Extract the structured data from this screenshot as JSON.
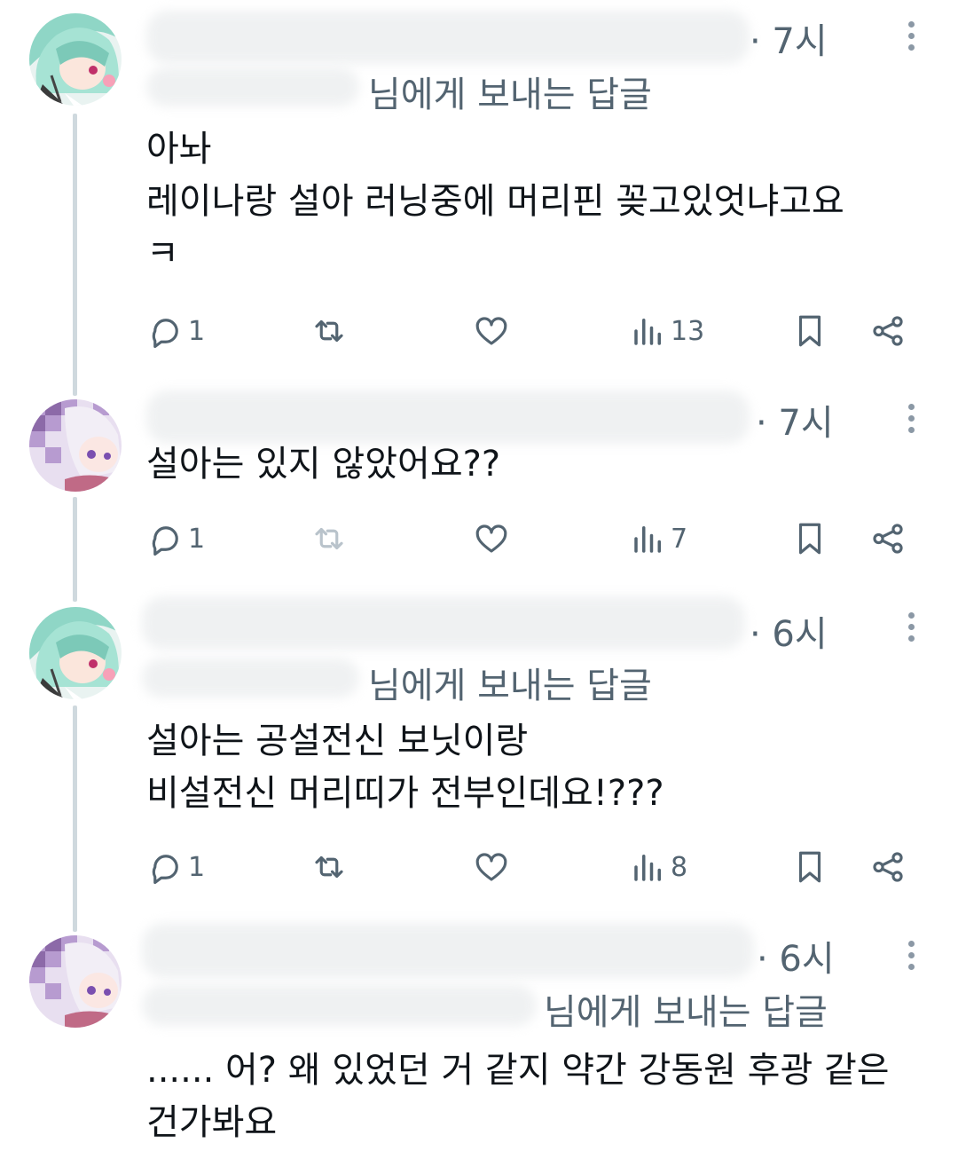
{
  "replying_suffix": "님에게 보내는 답글",
  "icons": [
    "reply-icon",
    "retweet-icon",
    "like-icon",
    "views-icon",
    "bookmark-icon",
    "share-icon",
    "more-icon"
  ],
  "colors": {
    "text": "#0f1419",
    "secondary": "#536471",
    "icon": "#536471",
    "thread_line": "#cfd9de"
  },
  "tweets": [
    {
      "time": "· 7시",
      "replying": "님에게 보내는 답글",
      "lines": [
        "아놔",
        "레이나랑 설아 러닝중에 머리핀 꽂고있엇냐고요",
        "ㅋ"
      ],
      "replies": "1",
      "views": "13"
    },
    {
      "time": "· 7시",
      "lines": [
        "설아는 있지 않았어요??"
      ],
      "replies": "1",
      "views": "7"
    },
    {
      "time": "· 6시",
      "replying": "님에게 보내는 답글",
      "lines": [
        "설아는 공설전신 보닛이랑",
        "비설전신 머리띠가 전부인데요!???"
      ],
      "replies": "1",
      "views": "8"
    },
    {
      "time": "· 6시",
      "replying": "님에게 보내는 답글",
      "lines": [
        "...... 어? 왜 있었던 거 같지 약간 강동원 후광 같은",
        "건가봐요"
      ]
    }
  ]
}
